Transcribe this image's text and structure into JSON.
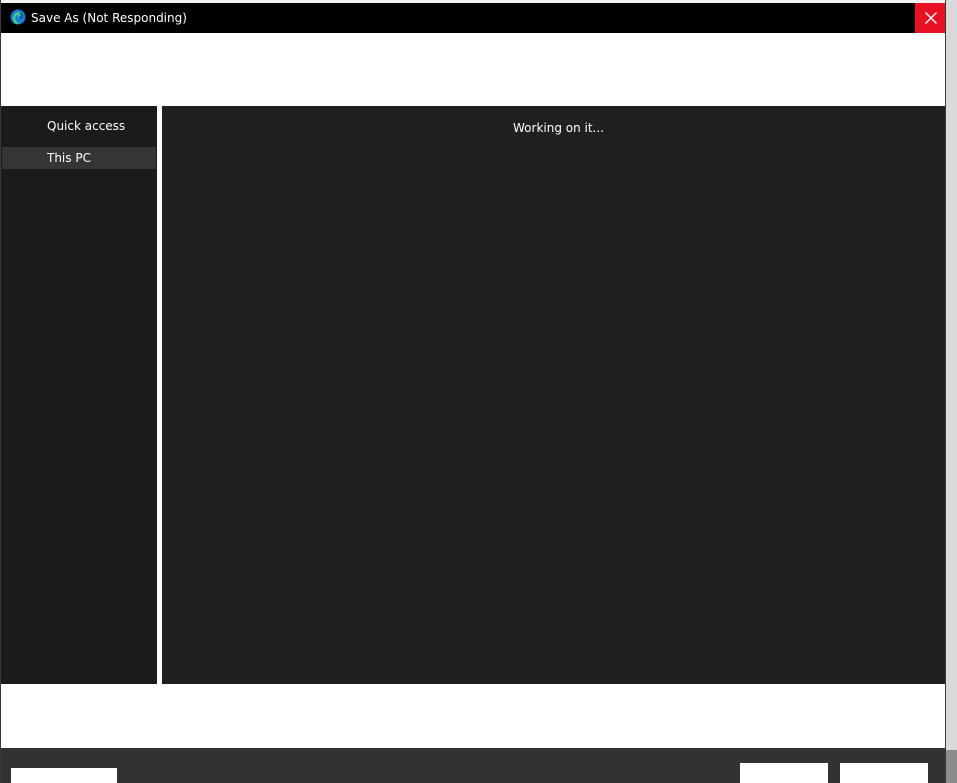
{
  "window": {
    "title": "Save As (Not Responding)",
    "icons": {
      "app": "edge-icon",
      "close": "close-icon"
    },
    "colors": {
      "titlebar": "#000000",
      "close_button": "#e81123",
      "navigation_background": "#1b1b1b",
      "content_background": "#202020",
      "selected_item": "#353535",
      "footer": "#323232"
    }
  },
  "navigation": {
    "items": [
      {
        "label": "Quick access",
        "selected": false
      },
      {
        "label": "This PC",
        "selected": true
      }
    ]
  },
  "main": {
    "status": "Working on it..."
  }
}
